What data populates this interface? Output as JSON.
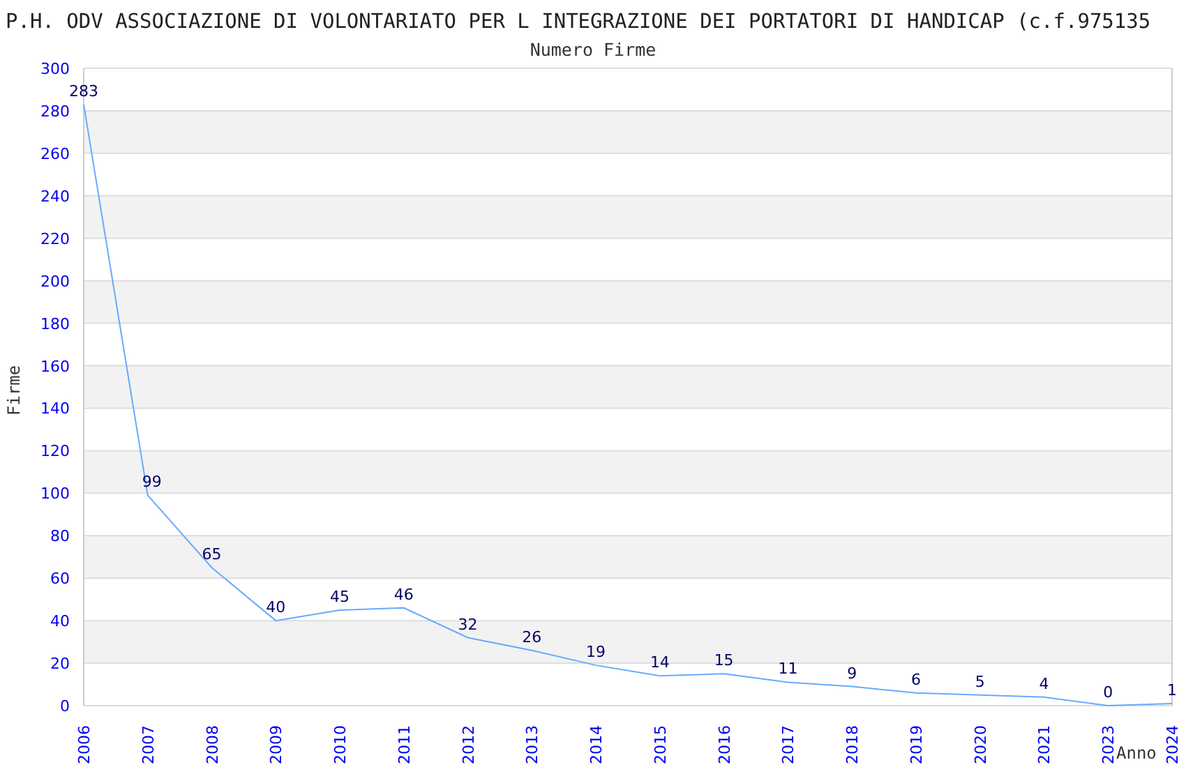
{
  "chart": {
    "title": "P.H. ODV ASSOCIAZIONE DI VOLONTARIATO PER L INTEGRAZIONE DEI PORTATORI DI HANDICAP (c.f.975135",
    "chart_data": {
      "type": "line",
      "title": "Numero Firme",
      "xlabel": "Anno",
      "ylabel": "Firme",
      "categories": [
        "2006",
        "2007",
        "2008",
        "2009",
        "2010",
        "2011",
        "2012",
        "2013",
        "2014",
        "2015",
        "2016",
        "2017",
        "2018",
        "2019",
        "2020",
        "2021",
        "2023",
        "2024"
      ],
      "grid": true,
      "series": [
        {
          "color": "#66aaff",
          "values": [
            283,
            99,
            65,
            40,
            45,
            46,
            32,
            26,
            19,
            14,
            15,
            11,
            9,
            6,
            5,
            4,
            0,
            1
          ]
        }
      ],
      "data_labels": true,
      "ylim": [
        0,
        300
      ],
      "yticks": [
        0,
        20,
        40,
        60,
        80,
        100,
        120,
        140,
        160,
        180,
        200,
        220,
        240,
        260,
        280,
        300
      ]
    }
  }
}
